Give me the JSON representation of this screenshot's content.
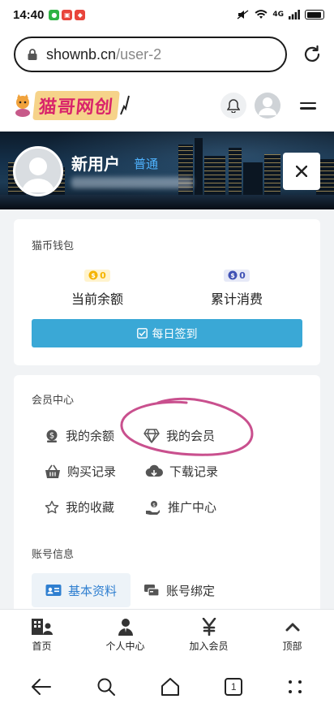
{
  "status_bar": {
    "time": "14:40",
    "network": "4G"
  },
  "browser": {
    "url_host": "shownb.cn",
    "url_path": "/user-2"
  },
  "site": {
    "logo_text": "猫哥网创"
  },
  "profile": {
    "username": "新用户",
    "level": "普通"
  },
  "wallet": {
    "title": "猫币钱包",
    "balance": {
      "value": "0",
      "label": "当前余额",
      "badge_color": "#f5b400"
    },
    "spent": {
      "value": "0",
      "label": "累计消费",
      "badge_color": "#3f51b5"
    },
    "sign_in_label": "每日签到"
  },
  "member_center": {
    "title": "会员中心",
    "items": [
      {
        "label": "我的余额",
        "icon": "dollar-badge-icon"
      },
      {
        "label": "我的会员",
        "icon": "diamond-icon"
      },
      {
        "label": "购买记录",
        "icon": "basket-icon"
      },
      {
        "label": "下载记录",
        "icon": "cloud-download-icon"
      },
      {
        "label": "我的收藏",
        "icon": "star-icon"
      },
      {
        "label": "推广中心",
        "icon": "hand-coin-icon"
      }
    ]
  },
  "account": {
    "title": "账号信息",
    "tabs": [
      {
        "label": "基本资料",
        "icon": "id-card-icon",
        "active": true
      },
      {
        "label": "账号绑定",
        "icon": "link-icon",
        "active": false
      }
    ]
  },
  "bottom_nav": [
    {
      "label": "首页",
      "icon": "building-user-icon"
    },
    {
      "label": "个人中心",
      "icon": "user-tie-icon"
    },
    {
      "label": "加入会员",
      "icon": "yen-icon"
    },
    {
      "label": "顶部",
      "icon": "chevron-up-icon"
    }
  ],
  "system_nav": {
    "tab_count": "1"
  },
  "colors": {
    "accent": "#3aa8d6",
    "active_tab_text": "#2f7fd0",
    "annotation": "#c0317a"
  }
}
